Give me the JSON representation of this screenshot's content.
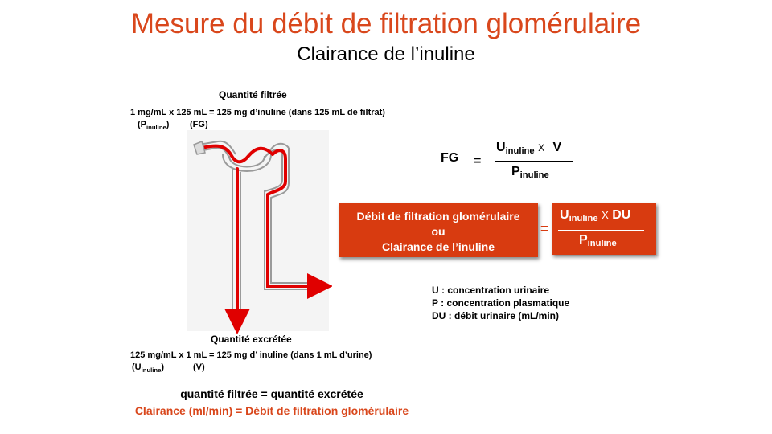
{
  "title": "Mesure du débit de filtration glomérulaire",
  "subtitle": "Clairance de l’inuline",
  "filtered": {
    "heading": "Quantité filtrée",
    "formula": "1 mg/mL  x 125 mL = 125 mg d’inuline  (dans 125 mL de filtrat)",
    "p_label": "P",
    "p_sub": "inuline",
    "fg_label": "(FG)"
  },
  "excreted": {
    "heading": "Quantité excrétée",
    "formula": "125 mg/mL  x 1 mL = 125 mg d’ inuline  (dans 1 mL d’urine)",
    "u_label": "U",
    "u_sub": "inuline",
    "v_label": "(V)"
  },
  "formula_fg": {
    "lhs": "FG",
    "equals": "=",
    "num_var": "U",
    "num_sub": "inuline",
    "times": "X",
    "num_v": "V",
    "den_var": "P",
    "den_sub": "inuline"
  },
  "red_box": {
    "line1": "Débit de filtration glomérulaire",
    "line2": "ou",
    "line3": "Clairance de l’inuline",
    "equals": "=",
    "num_var": "U",
    "num_sub": "inuline",
    "times": "X",
    "num_du": "DU",
    "den_var": "P",
    "den_sub": "inuline"
  },
  "legend": [
    "U : concentration urinaire",
    "P : concentration plasmatique",
    "DU : débit urinaire (mL/min)"
  ],
  "bottom_eq": "quantité filtrée = quantité excrétée",
  "bottom_red": "Clairance (ml/min)  = Débit de filtration  glomérulaire",
  "colors": {
    "accent": "#d9471c",
    "box": "#d83b10",
    "flow": "#e00000"
  }
}
